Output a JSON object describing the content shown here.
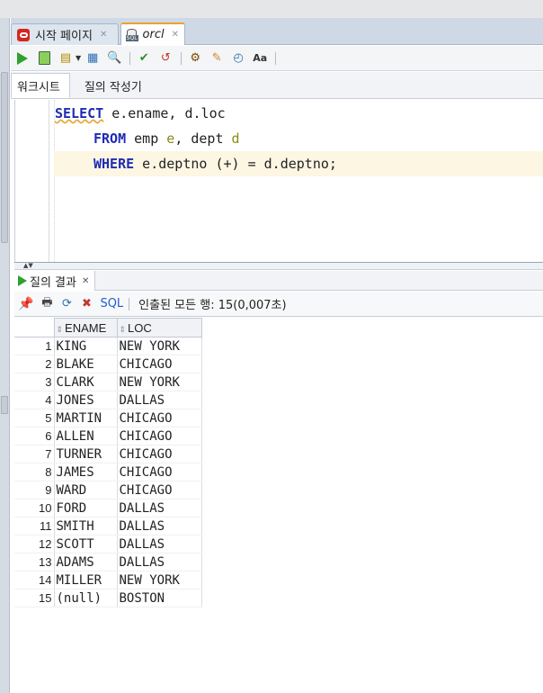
{
  "doc_tabs": [
    {
      "label": "시작 페이지",
      "icon": "oracle-icon"
    },
    {
      "label": "orcl",
      "icon": "database-connection-icon"
    }
  ],
  "toolbar": {
    "buttons": [
      "run-statement",
      "run-script",
      "autotrace",
      "explain-plan",
      "sql-tuning",
      "commit",
      "rollback",
      "unshared-sql",
      "clear",
      "history",
      "format"
    ]
  },
  "worksheet_tabs": [
    "워크시트",
    "질의 작성기"
  ],
  "editor": {
    "lines": [
      {
        "kw": "SELECT",
        "rest": " e.ename, d.loc"
      },
      {
        "kw": "FROM",
        "rest1": " emp ",
        "alias1": "e",
        "rest2": ", dept ",
        "alias2": "d"
      },
      {
        "kw": "WHERE",
        "rest": " e.deptno (+) = d.deptno;"
      }
    ]
  },
  "results": {
    "tab_label": "질의 결과",
    "sql_label": "SQL",
    "status": "인출된 모든 행: 15(0,007초)",
    "columns": [
      "ENAME",
      "LOC"
    ],
    "rows": [
      [
        "1",
        "KING",
        "NEW YORK"
      ],
      [
        "2",
        "BLAKE",
        "CHICAGO"
      ],
      [
        "3",
        "CLARK",
        "NEW YORK"
      ],
      [
        "4",
        "JONES",
        "DALLAS"
      ],
      [
        "5",
        "MARTIN",
        "CHICAGO"
      ],
      [
        "6",
        "ALLEN",
        "CHICAGO"
      ],
      [
        "7",
        "TURNER",
        "CHICAGO"
      ],
      [
        "8",
        "JAMES",
        "CHICAGO"
      ],
      [
        "9",
        "WARD",
        "CHICAGO"
      ],
      [
        "10",
        "FORD",
        "DALLAS"
      ],
      [
        "11",
        "SMITH",
        "DALLAS"
      ],
      [
        "12",
        "SCOTT",
        "DALLAS"
      ],
      [
        "13",
        "ADAMS",
        "DALLAS"
      ],
      [
        "14",
        "MILLER",
        "NEW YORK"
      ],
      [
        "15",
        "(null)",
        "BOSTON"
      ]
    ]
  }
}
